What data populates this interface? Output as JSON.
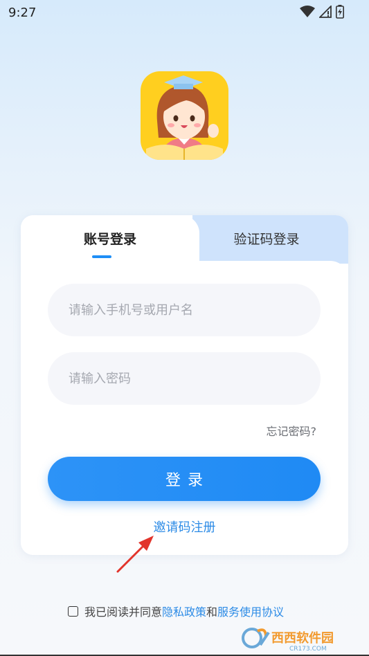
{
  "status_bar": {
    "time": "9:27",
    "icons": [
      "wifi-icon",
      "signal-icon",
      "battery-icon"
    ]
  },
  "app": {
    "logo_name": "teacher-girl-logo"
  },
  "login_card": {
    "tabs": [
      {
        "label": "账号登录",
        "active": true
      },
      {
        "label": "验证码登录",
        "active": false
      }
    ],
    "phone_placeholder": "请输入手机号或用户名",
    "password_placeholder": "请输入密码",
    "forgot_password": "忘记密码?",
    "login_button": "登录",
    "invite_register": "邀请码注册"
  },
  "agreement": {
    "prefix": "我已阅读并同意",
    "privacy_policy": "隐私政策",
    "and": "和",
    "service_agreement": "服务使用协议",
    "checked": false
  },
  "watermark": {
    "text": "西西软件园",
    "subtext": "CR173.COM"
  },
  "colors": {
    "accent": "#1f8af4",
    "link": "#2c8be6",
    "tab_inactive_bg": "#cfe3fc",
    "input_bg": "#f5f6fa"
  }
}
